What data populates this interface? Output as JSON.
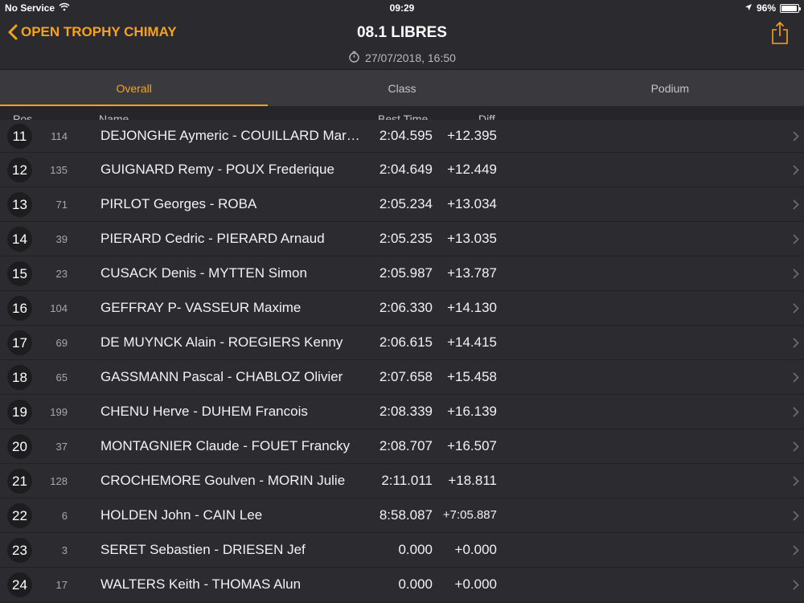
{
  "status": {
    "carrier": "No Service",
    "time": "09:29",
    "battery": "96%",
    "battery_level": 0.96
  },
  "nav": {
    "back_label": "OPEN TROPHY CHIMAY",
    "title": "08.1 LIBRES",
    "subtitle": "27/07/2018, 16:50"
  },
  "tabs": [
    {
      "label": "Overall",
      "active": true
    },
    {
      "label": "Class",
      "active": false
    },
    {
      "label": "Podium",
      "active": false
    }
  ],
  "columns": {
    "pos": "Pos",
    "name": "Name",
    "best_time": "Best Time",
    "diff": "Diff"
  },
  "rows": [
    {
      "pos": "11",
      "num": "114",
      "name": "DEJONGHE Aymeric - COUILLARD Mar…",
      "time": "2:04.595",
      "diff": "+12.395"
    },
    {
      "pos": "12",
      "num": "135",
      "name": "GUIGNARD Remy - POUX Frederique",
      "time": "2:04.649",
      "diff": "+12.449"
    },
    {
      "pos": "13",
      "num": "71",
      "name": "PIRLOT Georges - ROBA",
      "time": "2:05.234",
      "diff": "+13.034"
    },
    {
      "pos": "14",
      "num": "39",
      "name": "PIERARD Cedric - PIERARD Arnaud",
      "time": "2:05.235",
      "diff": "+13.035"
    },
    {
      "pos": "15",
      "num": "23",
      "name": "CUSACK Denis - MYTTEN Simon",
      "time": "2:05.987",
      "diff": "+13.787"
    },
    {
      "pos": "16",
      "num": "104",
      "name": "GEFFRAY P- VASSEUR Maxime",
      "time": "2:06.330",
      "diff": "+14.130"
    },
    {
      "pos": "17",
      "num": "69",
      "name": "DE MUYNCK Alain - ROEGIERS Kenny",
      "time": "2:06.615",
      "diff": "+14.415"
    },
    {
      "pos": "18",
      "num": "65",
      "name": "GASSMANN Pascal - CHABLOZ Olivier",
      "time": "2:07.658",
      "diff": "+15.458"
    },
    {
      "pos": "19",
      "num": "199",
      "name": "CHENU Herve - DUHEM Francois",
      "time": "2:08.339",
      "diff": "+16.139"
    },
    {
      "pos": "20",
      "num": "37",
      "name": "MONTAGNIER Claude - FOUET Francky",
      "time": "2:08.707",
      "diff": "+16.507"
    },
    {
      "pos": "21",
      "num": "128",
      "name": "CROCHEMORE Goulven - MORIN Julie",
      "time": "2:11.011",
      "diff": "+18.811"
    },
    {
      "pos": "22",
      "num": "6",
      "name": "HOLDEN John - CAIN Lee",
      "time": "8:58.087",
      "diff": "+7:05.887"
    },
    {
      "pos": "23",
      "num": "3",
      "name": "SERET Sebastien - DRIESEN Jef",
      "time": "0.000",
      "diff": "+0.000"
    },
    {
      "pos": "24",
      "num": "17",
      "name": "WALTERS Keith - THOMAS Alun",
      "time": "0.000",
      "diff": "+0.000"
    }
  ],
  "colors": {
    "accent": "#f7a21b",
    "background": "#2b2b2f",
    "tab_bar": "#3a3a3e"
  },
  "icons": {
    "back": "chevron-left-icon",
    "clock": "stopwatch-icon",
    "share": "share-icon",
    "row": "chevron-right-icon"
  }
}
